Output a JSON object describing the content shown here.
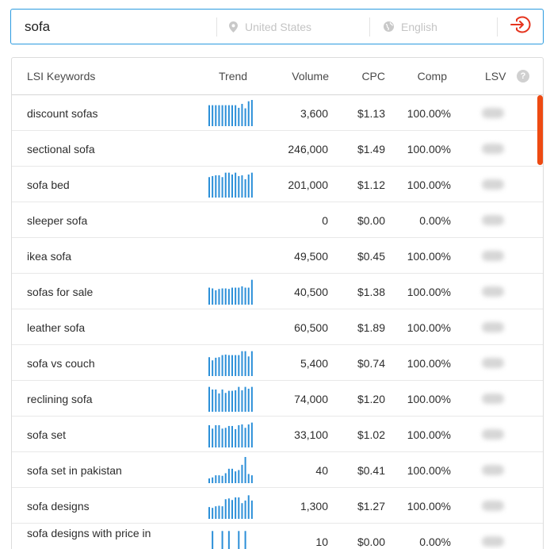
{
  "search": {
    "query": "sofa",
    "country_placeholder": "United States",
    "language_placeholder": "English",
    "location_icon": "location-pin-icon",
    "language_icon": "globe-icon",
    "submit_icon": "login-arrow-icon",
    "accent": "#e5341e"
  },
  "table": {
    "headers": {
      "keyword": "LSI Keywords",
      "trend": "Trend",
      "volume": "Volume",
      "cpc": "CPC",
      "comp": "Comp",
      "lsv": "LSV"
    },
    "help_label": "?",
    "trend_color": "#2b8fd8",
    "scroll_color": "#ee4a12",
    "rows": [
      {
        "keyword": "discount sofas",
        "volume": "3,600",
        "cpc": "$1.13",
        "comp": "100.00%",
        "trend": [
          0.8,
          0.8,
          0.8,
          0.8,
          0.8,
          0.8,
          0.8,
          0.8,
          0.8,
          0.7,
          0.85,
          0.68,
          0.95,
          1.0
        ]
      },
      {
        "keyword": "sectional sofa",
        "volume": "246,000",
        "cpc": "$1.49",
        "comp": "100.00%",
        "trend": []
      },
      {
        "keyword": "sofa bed",
        "volume": "201,000",
        "cpc": "$1.12",
        "comp": "100.00%",
        "trend": [
          0.78,
          0.82,
          0.85,
          0.85,
          0.78,
          0.95,
          0.95,
          0.88,
          0.95,
          0.82,
          0.85,
          0.7,
          0.88,
          0.95
        ]
      },
      {
        "keyword": "sleeper sofa",
        "volume": "0",
        "cpc": "$0.00",
        "comp": "0.00%",
        "trend": []
      },
      {
        "keyword": "ikea sofa",
        "volume": "49,500",
        "cpc": "$0.45",
        "comp": "100.00%",
        "trend": []
      },
      {
        "keyword": "sofas for sale",
        "volume": "40,500",
        "cpc": "$1.38",
        "comp": "100.00%",
        "trend": [
          0.65,
          0.62,
          0.55,
          0.6,
          0.62,
          0.62,
          0.6,
          0.65,
          0.65,
          0.65,
          0.7,
          0.65,
          0.65,
          0.95
        ]
      },
      {
        "keyword": "leather sofa",
        "volume": "60,500",
        "cpc": "$1.89",
        "comp": "100.00%",
        "trend": []
      },
      {
        "keyword": "sofa vs couch",
        "volume": "5,400",
        "cpc": "$0.74",
        "comp": "100.00%",
        "trend": [
          0.72,
          0.6,
          0.7,
          0.72,
          0.8,
          0.82,
          0.8,
          0.8,
          0.8,
          0.8,
          0.95,
          0.95,
          0.75,
          0.95
        ]
      },
      {
        "keyword": "reclining sofa",
        "volume": "74,000",
        "cpc": "$1.20",
        "comp": "100.00%",
        "trend": [
          0.95,
          0.85,
          0.85,
          0.7,
          0.85,
          0.72,
          0.8,
          0.8,
          0.82,
          0.95,
          0.82,
          0.95,
          0.88,
          0.95
        ]
      },
      {
        "keyword": "sofa set",
        "volume": "33,100",
        "cpc": "$1.02",
        "comp": "100.00%",
        "trend": [
          0.85,
          0.72,
          0.85,
          0.85,
          0.72,
          0.75,
          0.82,
          0.82,
          0.7,
          0.85,
          0.88,
          0.75,
          0.88,
          0.95
        ]
      },
      {
        "keyword": "sofa set in pakistan",
        "volume": "40",
        "cpc": "$0.41",
        "comp": "100.00%",
        "trend": [
          0.18,
          0.22,
          0.3,
          0.3,
          0.28,
          0.38,
          0.55,
          0.55,
          0.45,
          0.5,
          0.7,
          1.0,
          0.35,
          0.3
        ]
      },
      {
        "keyword": "sofa designs",
        "volume": "1,300",
        "cpc": "$1.27",
        "comp": "100.00%",
        "trend": [
          0.45,
          0.42,
          0.48,
          0.5,
          0.48,
          0.75,
          0.78,
          0.72,
          0.82,
          0.82,
          0.6,
          0.7,
          0.9,
          0.7
        ]
      },
      {
        "keyword": "sofa designs with price in",
        "volume": "10",
        "cpc": "$0.00",
        "comp": "0.00%",
        "trend": [
          0,
          0.9,
          0,
          0,
          0.9,
          0,
          0.9,
          0,
          0,
          0.9,
          0,
          0.9,
          0,
          0
        ]
      }
    ]
  }
}
